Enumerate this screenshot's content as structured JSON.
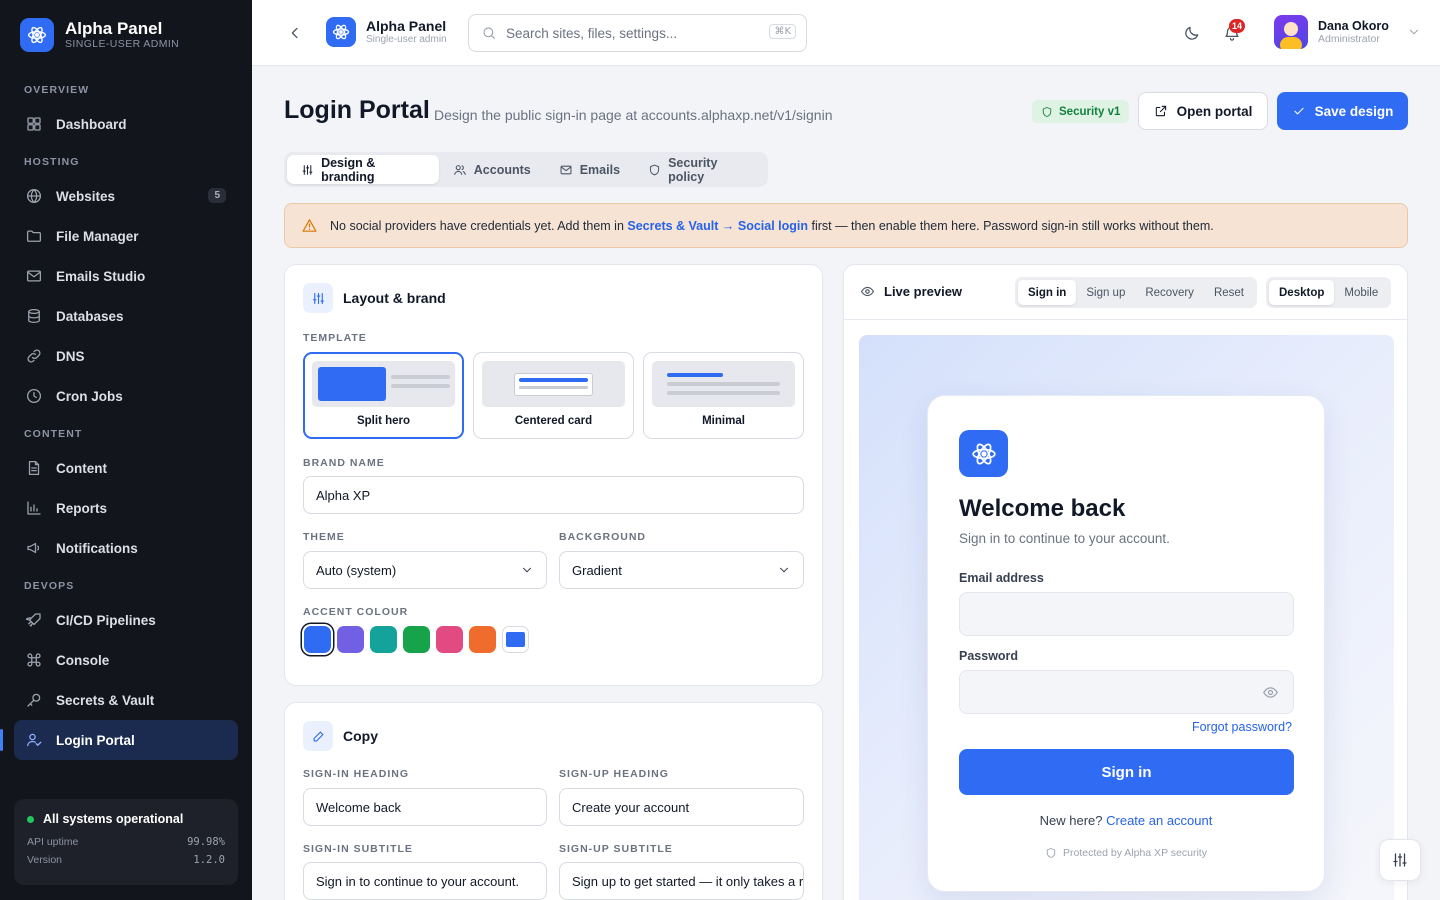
{
  "app": {
    "name": "Alpha Panel",
    "subtitle": "SINGLE-USER ADMIN"
  },
  "sidebar": {
    "sections": [
      {
        "label": "OVERVIEW",
        "items": [
          {
            "label": "Dashboard",
            "icon": "grid-icon"
          }
        ]
      },
      {
        "label": "HOSTING",
        "items": [
          {
            "label": "Websites",
            "icon": "globe-icon",
            "badge": "5"
          },
          {
            "label": "File Manager",
            "icon": "folder-icon"
          },
          {
            "label": "Emails Studio",
            "icon": "mail-icon"
          },
          {
            "label": "Databases",
            "icon": "database-icon"
          },
          {
            "label": "DNS",
            "icon": "link-icon"
          },
          {
            "label": "Cron Jobs",
            "icon": "clock-icon"
          }
        ]
      },
      {
        "label": "CONTENT",
        "items": [
          {
            "label": "Content",
            "icon": "document-icon"
          },
          {
            "label": "Reports",
            "icon": "bar-chart-icon"
          },
          {
            "label": "Notifications",
            "icon": "megaphone-icon"
          }
        ]
      },
      {
        "label": "DEVOPS",
        "items": [
          {
            "label": "CI/CD Pipelines",
            "icon": "rocket-icon"
          },
          {
            "label": "Console",
            "icon": "command-icon"
          },
          {
            "label": "Secrets & Vault",
            "icon": "key-icon"
          },
          {
            "label": "Login Portal",
            "icon": "user-check-icon",
            "active": true
          }
        ]
      }
    ],
    "status": {
      "label": "All systems operational",
      "uptime_label": "API uptime",
      "uptime_value": "99.98%",
      "version_label": "Version",
      "version_value": "1.2.0"
    }
  },
  "topbar": {
    "title": "Alpha Panel",
    "subtitle": "Single-user admin",
    "search_placeholder": "Search sites, files, settings...",
    "search_shortcut": "⌘K",
    "notifications_count": "14",
    "user": {
      "name": "Dana Okoro",
      "role": "Administrator"
    }
  },
  "header": {
    "title": "Login Portal",
    "description": "Design the public sign-in page at accounts.alphaxp.net/v1/signin",
    "security_badge": "Security v1",
    "open_portal": "Open portal",
    "save_design": "Save design"
  },
  "tabs": [
    {
      "label": "Design & branding",
      "icon": "sliders-icon",
      "active": true
    },
    {
      "label": "Accounts",
      "icon": "users-icon"
    },
    {
      "label": "Emails",
      "icon": "mail-icon"
    },
    {
      "label": "Security policy",
      "icon": "shield-icon"
    }
  ],
  "alert": {
    "prefix": "No social providers have credentials yet. Add them in ",
    "link": "Secrets & Vault → Social login",
    "suffix": " first — then enable them here. Password sign-in still works without them."
  },
  "layout_card": {
    "title": "Layout & brand",
    "template_label": "TEMPLATE",
    "templates": [
      {
        "name": "Split hero",
        "selected": true
      },
      {
        "name": "Centered card"
      },
      {
        "name": "Minimal"
      }
    ],
    "brand_name_label": "BRAND NAME",
    "brand_name": "Alpha XP",
    "theme_label": "THEME",
    "theme": "Auto (system)",
    "background_label": "BACKGROUND",
    "background": "Gradient",
    "accent_label": "ACCENT COLOUR",
    "accents": [
      "#2f6bf3",
      "#7260e4",
      "#14a39a",
      "#16a34a",
      "#e24b82",
      "#ef6c2c"
    ],
    "custom_accent": "#2f6bf3"
  },
  "copy_card": {
    "title": "Copy",
    "signin_heading_label": "SIGN-IN HEADING",
    "signin_heading": "Welcome back",
    "signup_heading_label": "SIGN-UP HEADING",
    "signup_heading": "Create your account",
    "signin_subtitle_label": "SIGN-IN SUBTITLE",
    "signin_subtitle": "Sign in to continue to your account.",
    "signup_subtitle_label": "SIGN-UP SUBTITLE",
    "signup_subtitle": "Sign up to get started — it only takes a r"
  },
  "preview": {
    "label": "Live preview",
    "modes": [
      "Sign in",
      "Sign up",
      "Recovery",
      "Reset"
    ],
    "active_mode": "Sign in",
    "devices": [
      "Desktop",
      "Mobile"
    ],
    "active_device": "Desktop",
    "card": {
      "title": "Welcome back",
      "subtitle": "Sign in to continue to your account.",
      "email_label": "Email address",
      "password_label": "Password",
      "forgot": "Forgot password?",
      "button": "Sign in",
      "new_here": "New here?",
      "create_account": "Create an account",
      "protected": "Protected by Alpha XP security"
    }
  }
}
